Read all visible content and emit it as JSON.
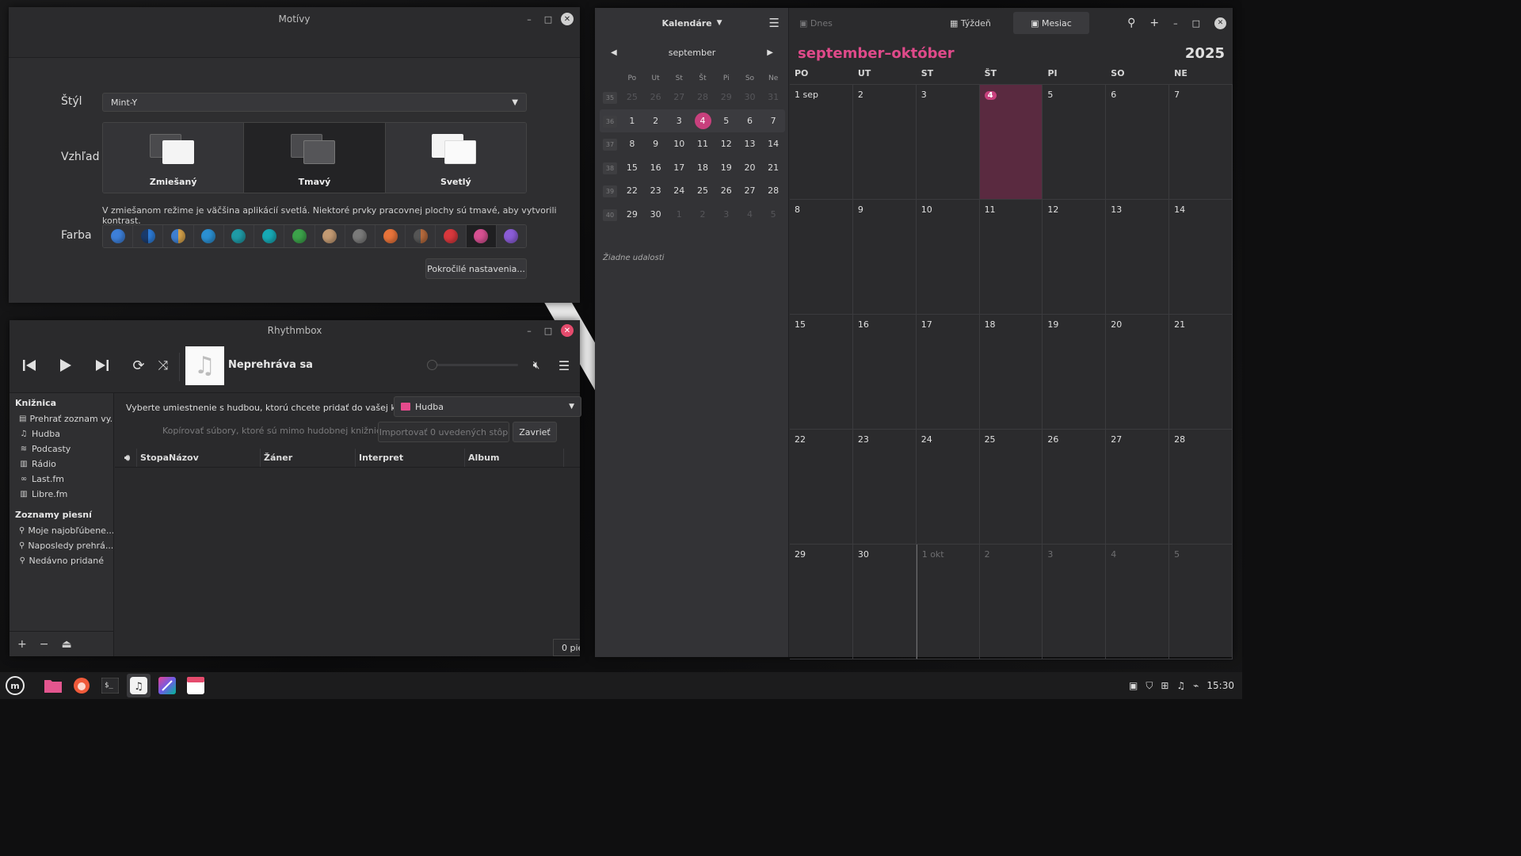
{
  "motivy": {
    "title": "Motívy",
    "style_label": "Štýl",
    "style_value": "Mint-Y",
    "look_label": "Vzhľad",
    "looks": [
      "Zmiešaný",
      "Tmavý",
      "Svetlý"
    ],
    "hint": "V zmiešanom režime je väčšina aplikácií svetlá. Niektoré prvky pracovnej plochy sú tmavé, aby vytvorili kontrast.",
    "color_label": "Farba",
    "swatches": [
      "#3d7fd9",
      "#2d7bd6",
      "#d6a24a",
      "#2b8fd1",
      "#1f9aa6",
      "#17a9b5",
      "#3ca24a",
      "#c39a73",
      "#7a7a7a",
      "#e8733a",
      "#b56a3d",
      "#d8383d",
      "#d65091",
      "#8a5cd6"
    ],
    "advanced_button": "Pokročilé nastavenia..."
  },
  "rhythmbox": {
    "title": "Rhythmbox",
    "now_playing": "Neprehráva sa",
    "sidebar": {
      "library_header": "Knižnica",
      "library_items": [
        "Prehrať zoznam vy...",
        "Hudba",
        "Podcasty",
        "Rádio",
        "Last.fm",
        "Libre.fm"
      ],
      "playlists_header": "Zoznamy piesní",
      "playlists": [
        "Moje najobľúbene...",
        "Naposledy prehrá...",
        "Nedávno pridané"
      ]
    },
    "import_label": "Vyberte umiestnenie s hudbou, ktorú chcete pridať do vašej knižnice:",
    "import_location": "Hudba",
    "copy_checkbox": "Kopírovať súbory, ktoré sú mimo hudobnej knižnice",
    "import_button": "Importovať 0 uvedených stôp",
    "close_button": "Zavrieť",
    "columns": [
      "Stopa",
      "Názov",
      "Žáner",
      "Interpret",
      "Album"
    ],
    "status": "0 pie"
  },
  "calendar": {
    "calendars_label": "Kalendáre",
    "mini_month": "september",
    "weekdays_short": [
      "Po",
      "Ut",
      "St",
      "Št",
      "Pi",
      "So",
      "Ne"
    ],
    "mini_weeks": [
      {
        "num": "35",
        "days": [
          "25",
          "26",
          "27",
          "28",
          "29",
          "30",
          "31"
        ]
      },
      {
        "num": "36",
        "days": [
          "1",
          "2",
          "3",
          "4",
          "5",
          "6",
          "7"
        ]
      },
      {
        "num": "37",
        "days": [
          "8",
          "9",
          "10",
          "11",
          "12",
          "13",
          "14"
        ]
      },
      {
        "num": "38",
        "days": [
          "15",
          "16",
          "17",
          "18",
          "19",
          "20",
          "21"
        ]
      },
      {
        "num": "39",
        "days": [
          "22",
          "23",
          "24",
          "25",
          "26",
          "27",
          "28"
        ]
      },
      {
        "num": "40",
        "days": [
          "29",
          "30",
          "1",
          "2",
          "3",
          "4",
          "5"
        ]
      }
    ],
    "no_events": "Žiadne udalosti",
    "today_button": "Dnes",
    "week_button": "Týždeň",
    "month_button": "Mesiac",
    "title": "september–október",
    "year": "2025",
    "weekdays": [
      "PO",
      "UT",
      "ST",
      "ŠT",
      "PI",
      "SO",
      "NE"
    ],
    "weeks": [
      [
        "1 sep",
        "2",
        "3",
        "4",
        "5",
        "6",
        "7"
      ],
      [
        "8",
        "9",
        "10",
        "11",
        "12",
        "13",
        "14"
      ],
      [
        "15",
        "16",
        "17",
        "18",
        "19",
        "20",
        "21"
      ],
      [
        "22",
        "23",
        "24",
        "25",
        "26",
        "27",
        "28"
      ],
      [
        "29",
        "30",
        "1 okt",
        "2",
        "3",
        "4",
        "5"
      ]
    ]
  },
  "taskbar": {
    "clock": "15:30"
  }
}
